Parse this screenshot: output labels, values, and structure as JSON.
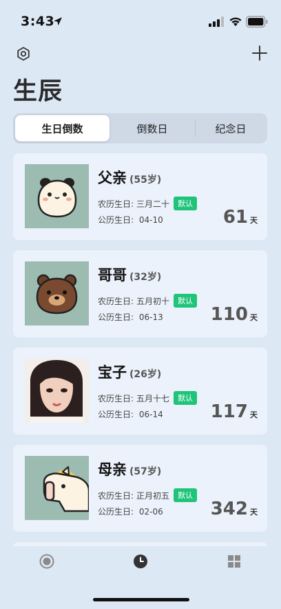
{
  "status_bar": {
    "time": "3:43"
  },
  "page": {
    "title": "生辰"
  },
  "segments": [
    {
      "label": "生日倒数",
      "active": true
    },
    {
      "label": "倒数日",
      "active": false
    },
    {
      "label": "纪念日",
      "active": false
    }
  ],
  "lunar_prefix": "农历生日:",
  "solar_prefix": "公历生日:",
  "people": [
    {
      "name": "父亲",
      "age": "(55岁)",
      "lunar": "三月二十",
      "badge": "默认",
      "solar": "04-10",
      "days": "61",
      "unit": "天",
      "avatar": "panda-avatar"
    },
    {
      "name": "哥哥",
      "age": "(32岁)",
      "lunar": "五月初十",
      "badge": "默认",
      "solar": "06-13",
      "days": "110",
      "unit": "天",
      "avatar": "bear-avatar"
    },
    {
      "name": "宝子",
      "age": "(26岁)",
      "lunar": "五月十七",
      "badge": "默认",
      "solar": "06-14",
      "days": "117",
      "unit": "天",
      "avatar": "girl-photo-avatar"
    },
    {
      "name": "母亲",
      "age": "(57岁)",
      "lunar": "正月初五",
      "badge": "默认",
      "solar": "02-06",
      "days": "342",
      "unit": "天",
      "avatar": "horse-avatar"
    }
  ],
  "colors": {
    "background": "#dde8f5",
    "card": "#ebf2fb",
    "badge": "#1fc37a",
    "avatar_bg": "#9dbcb1"
  },
  "tabs": [
    {
      "icon": "record-circle-icon"
    },
    {
      "icon": "clock-icon"
    },
    {
      "icon": "grid-icon"
    }
  ]
}
